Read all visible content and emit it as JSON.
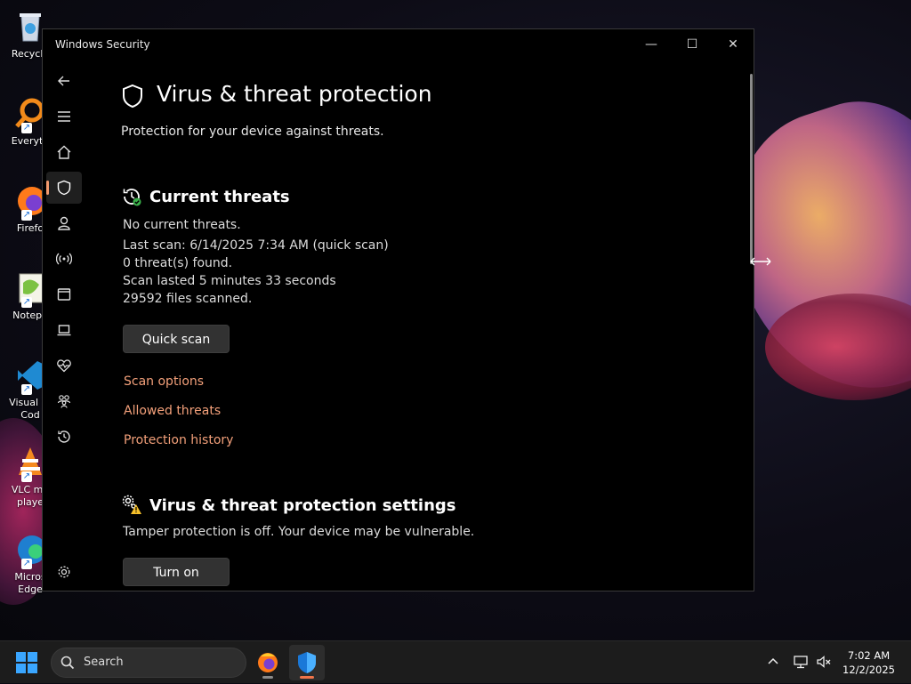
{
  "desktop": {
    "icons": [
      {
        "label": "Recycle",
        "icon": "recycle-bin-icon"
      },
      {
        "label": "Everyth",
        "icon": "everything-search-icon"
      },
      {
        "label": "Firefo",
        "icon": "firefox-icon"
      },
      {
        "label": "Notepa",
        "icon": "notepad-plus-plus-icon"
      },
      {
        "label": "Visual St\nCod",
        "icon": "vscode-icon"
      },
      {
        "label": "VLC me\nplaye",
        "icon": "vlc-icon"
      },
      {
        "label": "Micros\nEdge",
        "icon": "edge-icon"
      }
    ]
  },
  "window": {
    "title": "Windows Security",
    "controls": {
      "minimize": "—",
      "maximize": "☐",
      "close": "✕"
    },
    "nav": [
      {
        "name": "back",
        "icon": "back-arrow-icon"
      },
      {
        "name": "menu",
        "icon": "hamburger-menu-icon"
      },
      {
        "name": "home",
        "icon": "home-icon"
      },
      {
        "name": "virus-threat-protection",
        "icon": "shield-icon",
        "active": true
      },
      {
        "name": "account-protection",
        "icon": "person-icon"
      },
      {
        "name": "firewall-network",
        "icon": "wireless-antenna-icon"
      },
      {
        "name": "app-browser-control",
        "icon": "browser-window-icon"
      },
      {
        "name": "device-security",
        "icon": "laptop-icon"
      },
      {
        "name": "device-performance",
        "icon": "heart-pulse-icon"
      },
      {
        "name": "family-options",
        "icon": "family-icon"
      },
      {
        "name": "protection-history",
        "icon": "history-icon"
      },
      {
        "name": "settings",
        "icon": "gear-icon"
      }
    ],
    "page": {
      "title": "Virus & threat protection",
      "subtitle": "Protection for your device against threats.",
      "current_threats": {
        "heading": "Current threats",
        "status": "No current threats.",
        "last_scan": "Last scan: 6/14/2025 7:34 AM (quick scan)",
        "threats_found": "0 threat(s) found.",
        "scan_duration": "Scan lasted 5 minutes 33 seconds",
        "files_scanned": "29592 files scanned.",
        "quick_scan_button": "Quick scan",
        "links": [
          "Scan options",
          "Allowed threats",
          "Protection history"
        ]
      },
      "settings_section": {
        "heading": "Virus & threat protection settings",
        "message": "Tamper protection is off. Your device may be vulnerable.",
        "turn_on_button": "Turn on"
      }
    },
    "accent_color": "#f3a07a"
  },
  "taskbar": {
    "search_placeholder": "Search",
    "apps": [
      {
        "name": "firefox",
        "icon": "firefox-icon",
        "active": false
      },
      {
        "name": "windows-security",
        "icon": "shield-icon",
        "active": true
      }
    ],
    "tray_icons": [
      "chevron-up-icon",
      "network-icon",
      "volume-muted-icon"
    ],
    "time": "7:02 AM",
    "date": "12/2/2025"
  }
}
